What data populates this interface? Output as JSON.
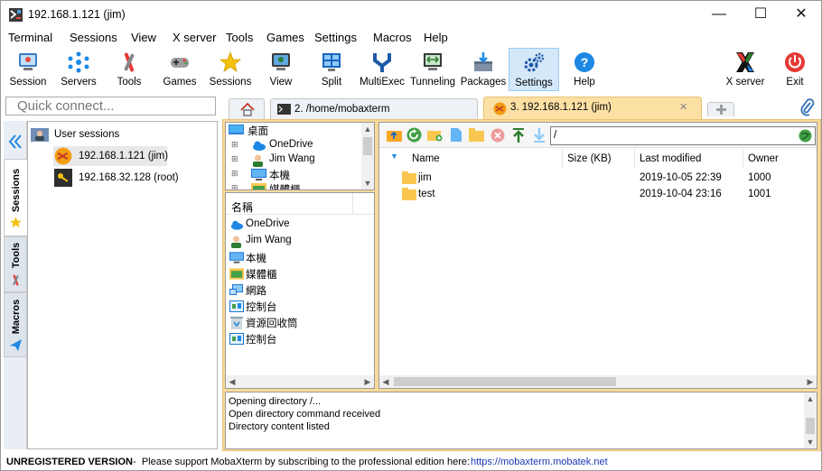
{
  "window": {
    "title": "192.168.1.121 (jim)",
    "minimize": "—",
    "maximize": "☐",
    "close": "✕"
  },
  "menu": [
    "Terminal",
    "Sessions",
    "View",
    "X server",
    "Tools",
    "Games",
    "Settings",
    "Macros",
    "Help"
  ],
  "toolbar": [
    {
      "label": "Session",
      "icon": "session-icon"
    },
    {
      "label": "Servers",
      "icon": "servers-icon"
    },
    {
      "label": "Tools",
      "icon": "tools-icon"
    },
    {
      "label": "Games",
      "icon": "games-icon"
    },
    {
      "label": "Sessions",
      "icon": "star-icon"
    },
    {
      "label": "View",
      "icon": "view-icon"
    },
    {
      "label": "Split",
      "icon": "split-icon"
    },
    {
      "label": "MultiExec",
      "icon": "multiexec-icon"
    },
    {
      "label": "Tunneling",
      "icon": "tunneling-icon"
    },
    {
      "label": "Packages",
      "icon": "packages-icon"
    },
    {
      "label": "Settings",
      "icon": "gear-icon"
    },
    {
      "label": "Help",
      "icon": "help-icon"
    },
    {
      "label": "X server",
      "icon": "x-server-icon"
    },
    {
      "label": "Exit",
      "icon": "power-icon"
    }
  ],
  "quick_connect": {
    "placeholder": "Quick connect..."
  },
  "tabs": [
    {
      "label": "2. /home/mobaxterm"
    },
    {
      "label": "3. 192.168.1.121 (jim)"
    }
  ],
  "side_tabs": [
    "Sessions",
    "Tools",
    "Macros"
  ],
  "sessions": {
    "root_label": "User sessions",
    "items": [
      {
        "label": "192.168.1.121 (jim)"
      },
      {
        "label": "192.168.32.128 (root)"
      }
    ]
  },
  "tree": {
    "root": "桌面",
    "items": [
      "OneDrive",
      "Jim Wang",
      "本機",
      "媒體櫃"
    ]
  },
  "names": {
    "header": "名稱",
    "items": [
      "OneDrive",
      "Jim Wang",
      "本機",
      "媒體櫃",
      "網路",
      "控制台",
      "資源回收筒",
      "控制台"
    ]
  },
  "sftp": {
    "path": "/",
    "columns": [
      "Name",
      "Size (KB)",
      "Last modified",
      "Owner"
    ],
    "rows": [
      {
        "name": "jim",
        "size": "",
        "modified": "2019-10-05 22:39",
        "owner": "1000"
      },
      {
        "name": "test",
        "size": "",
        "modified": "2019-10-04 23:16",
        "owner": "1001"
      }
    ]
  },
  "log": [
    "Opening directory /...",
    "Open directory command received",
    "Directory content listed"
  ],
  "status": {
    "bold": "UNREGISTERED VERSION",
    "text": " -  Please support MobaXterm by subscribing to the professional edition here: ",
    "link": "https://mobaxterm.mobatek.net"
  }
}
